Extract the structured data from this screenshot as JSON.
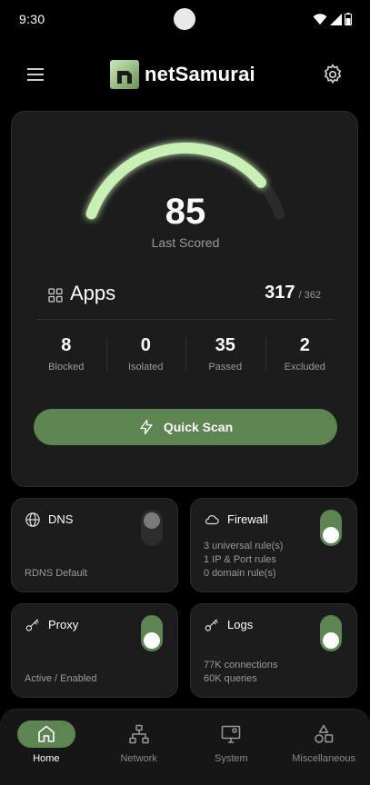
{
  "status_bar": {
    "time": "9:30"
  },
  "header": {
    "app_name": "netSamurai",
    "menu_icon": "hamburger-menu-icon",
    "settings_icon": "gear-icon"
  },
  "score": {
    "value": "85",
    "label": "Last Scored",
    "fraction": 0.85,
    "accent": "#c8f0b4"
  },
  "apps": {
    "title": "Apps",
    "count": "317",
    "total": "/ 362"
  },
  "stats": [
    {
      "value": "8",
      "label": "Blocked"
    },
    {
      "value": "0",
      "label": "Isolated"
    },
    {
      "value": "35",
      "label": "Passed"
    },
    {
      "value": "2",
      "label": "Excluded"
    }
  ],
  "quick_scan": {
    "label": "Quick Scan"
  },
  "tiles": {
    "dns": {
      "title": "DNS",
      "lines": [
        "RDNS Default"
      ],
      "enabled": false
    },
    "firewall": {
      "title": "Firewall",
      "lines": [
        "3 universal rule(s)",
        "1 IP & Port rules",
        "0 domain rule(s)"
      ],
      "enabled": true
    },
    "proxy": {
      "title": "Proxy",
      "lines": [
        "Active / Enabled"
      ],
      "enabled": true
    },
    "logs": {
      "title": "Logs",
      "lines": [
        "77K connections",
        "60K queries"
      ],
      "enabled": true
    }
  },
  "nav": [
    {
      "label": "Home",
      "icon": "home-icon",
      "active": true
    },
    {
      "label": "Network",
      "icon": "network-icon",
      "active": false
    },
    {
      "label": "System",
      "icon": "system-monitor-icon",
      "active": false
    },
    {
      "label": "Miscellaneous",
      "icon": "shapes-icon",
      "active": false
    }
  ],
  "colors": {
    "accent": "#5d8551",
    "gauge": "#c8f0b4",
    "card": "#1c1c1c"
  }
}
